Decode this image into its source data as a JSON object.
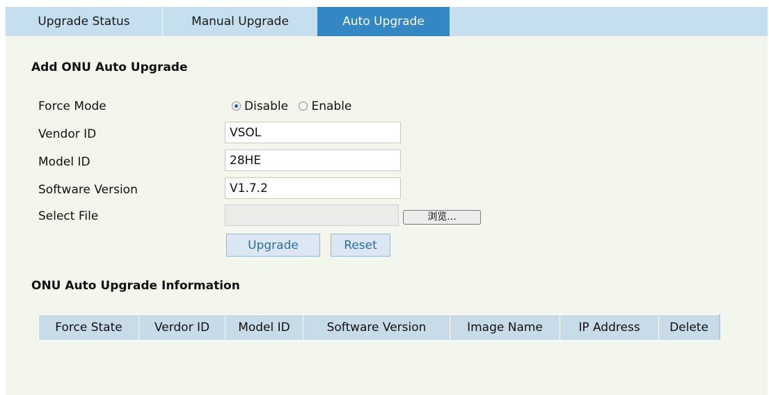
{
  "tabs": [
    {
      "label": "Upgrade Status"
    },
    {
      "label": "Manual Upgrade"
    },
    {
      "label": "Auto Upgrade",
      "active": true
    }
  ],
  "form": {
    "title": "Add ONU Auto Upgrade",
    "force_mode": {
      "label": "Force Mode",
      "options": [
        "Disable",
        "Enable"
      ],
      "selected": "Disable"
    },
    "vendor_id": {
      "label": "Vendor ID",
      "value": "VSOL"
    },
    "model_id": {
      "label": "Model ID",
      "value": "28HE"
    },
    "software_version": {
      "label": "Software Version",
      "value": "V1.7.2"
    },
    "select_file": {
      "label": "Select File",
      "value": "",
      "browse_label": "浏览..."
    },
    "upgrade_label": "Upgrade",
    "reset_label": "Reset"
  },
  "info": {
    "title": "ONU Auto Upgrade Information",
    "columns": [
      "Force State",
      "Verdor ID",
      "Model ID",
      "Software Version",
      "Image Name",
      "IP Address",
      "Delete"
    ]
  },
  "colors": {
    "tab_bar": "#c6dfee",
    "tab_active": "#3387c2",
    "panel_bg": "#f3f6ec",
    "button_bg": "#dbe8f3",
    "table_header": "#c7dbe9"
  }
}
